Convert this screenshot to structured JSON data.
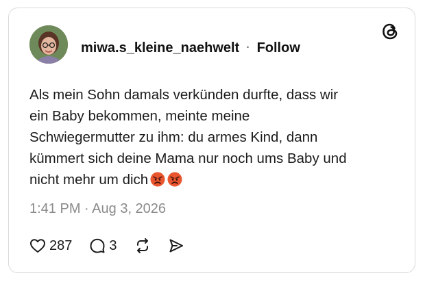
{
  "post": {
    "username": "miwa.s_kleine_naehwelt",
    "separator": "·",
    "follow_label": "Follow",
    "text": "Als mein Sohn damals verkünden durfte, dass wir\nein Baby bekommen, meinte meine\nSchwiegermutter zu ihm: du armes Kind, dann\nkümmert sich deine Mama nur noch ums Baby und\nnicht mehr um dich",
    "emojis": [
      "angry-face-emoji",
      "angry-face-emoji"
    ],
    "time": "1:41 PM",
    "date_separator": "·",
    "date": "Aug 3, 2026",
    "likes": "287",
    "comments": "3"
  },
  "icons": {
    "brand": "threads-logo-icon",
    "like": "heart-icon",
    "comment": "comment-bubble-icon",
    "repost": "repost-icon",
    "share": "send-icon"
  },
  "colors": {
    "text": "#1b1b1b",
    "muted": "#8a8a8a",
    "border": "#d9d9d9",
    "emoji": "#e8552e"
  }
}
